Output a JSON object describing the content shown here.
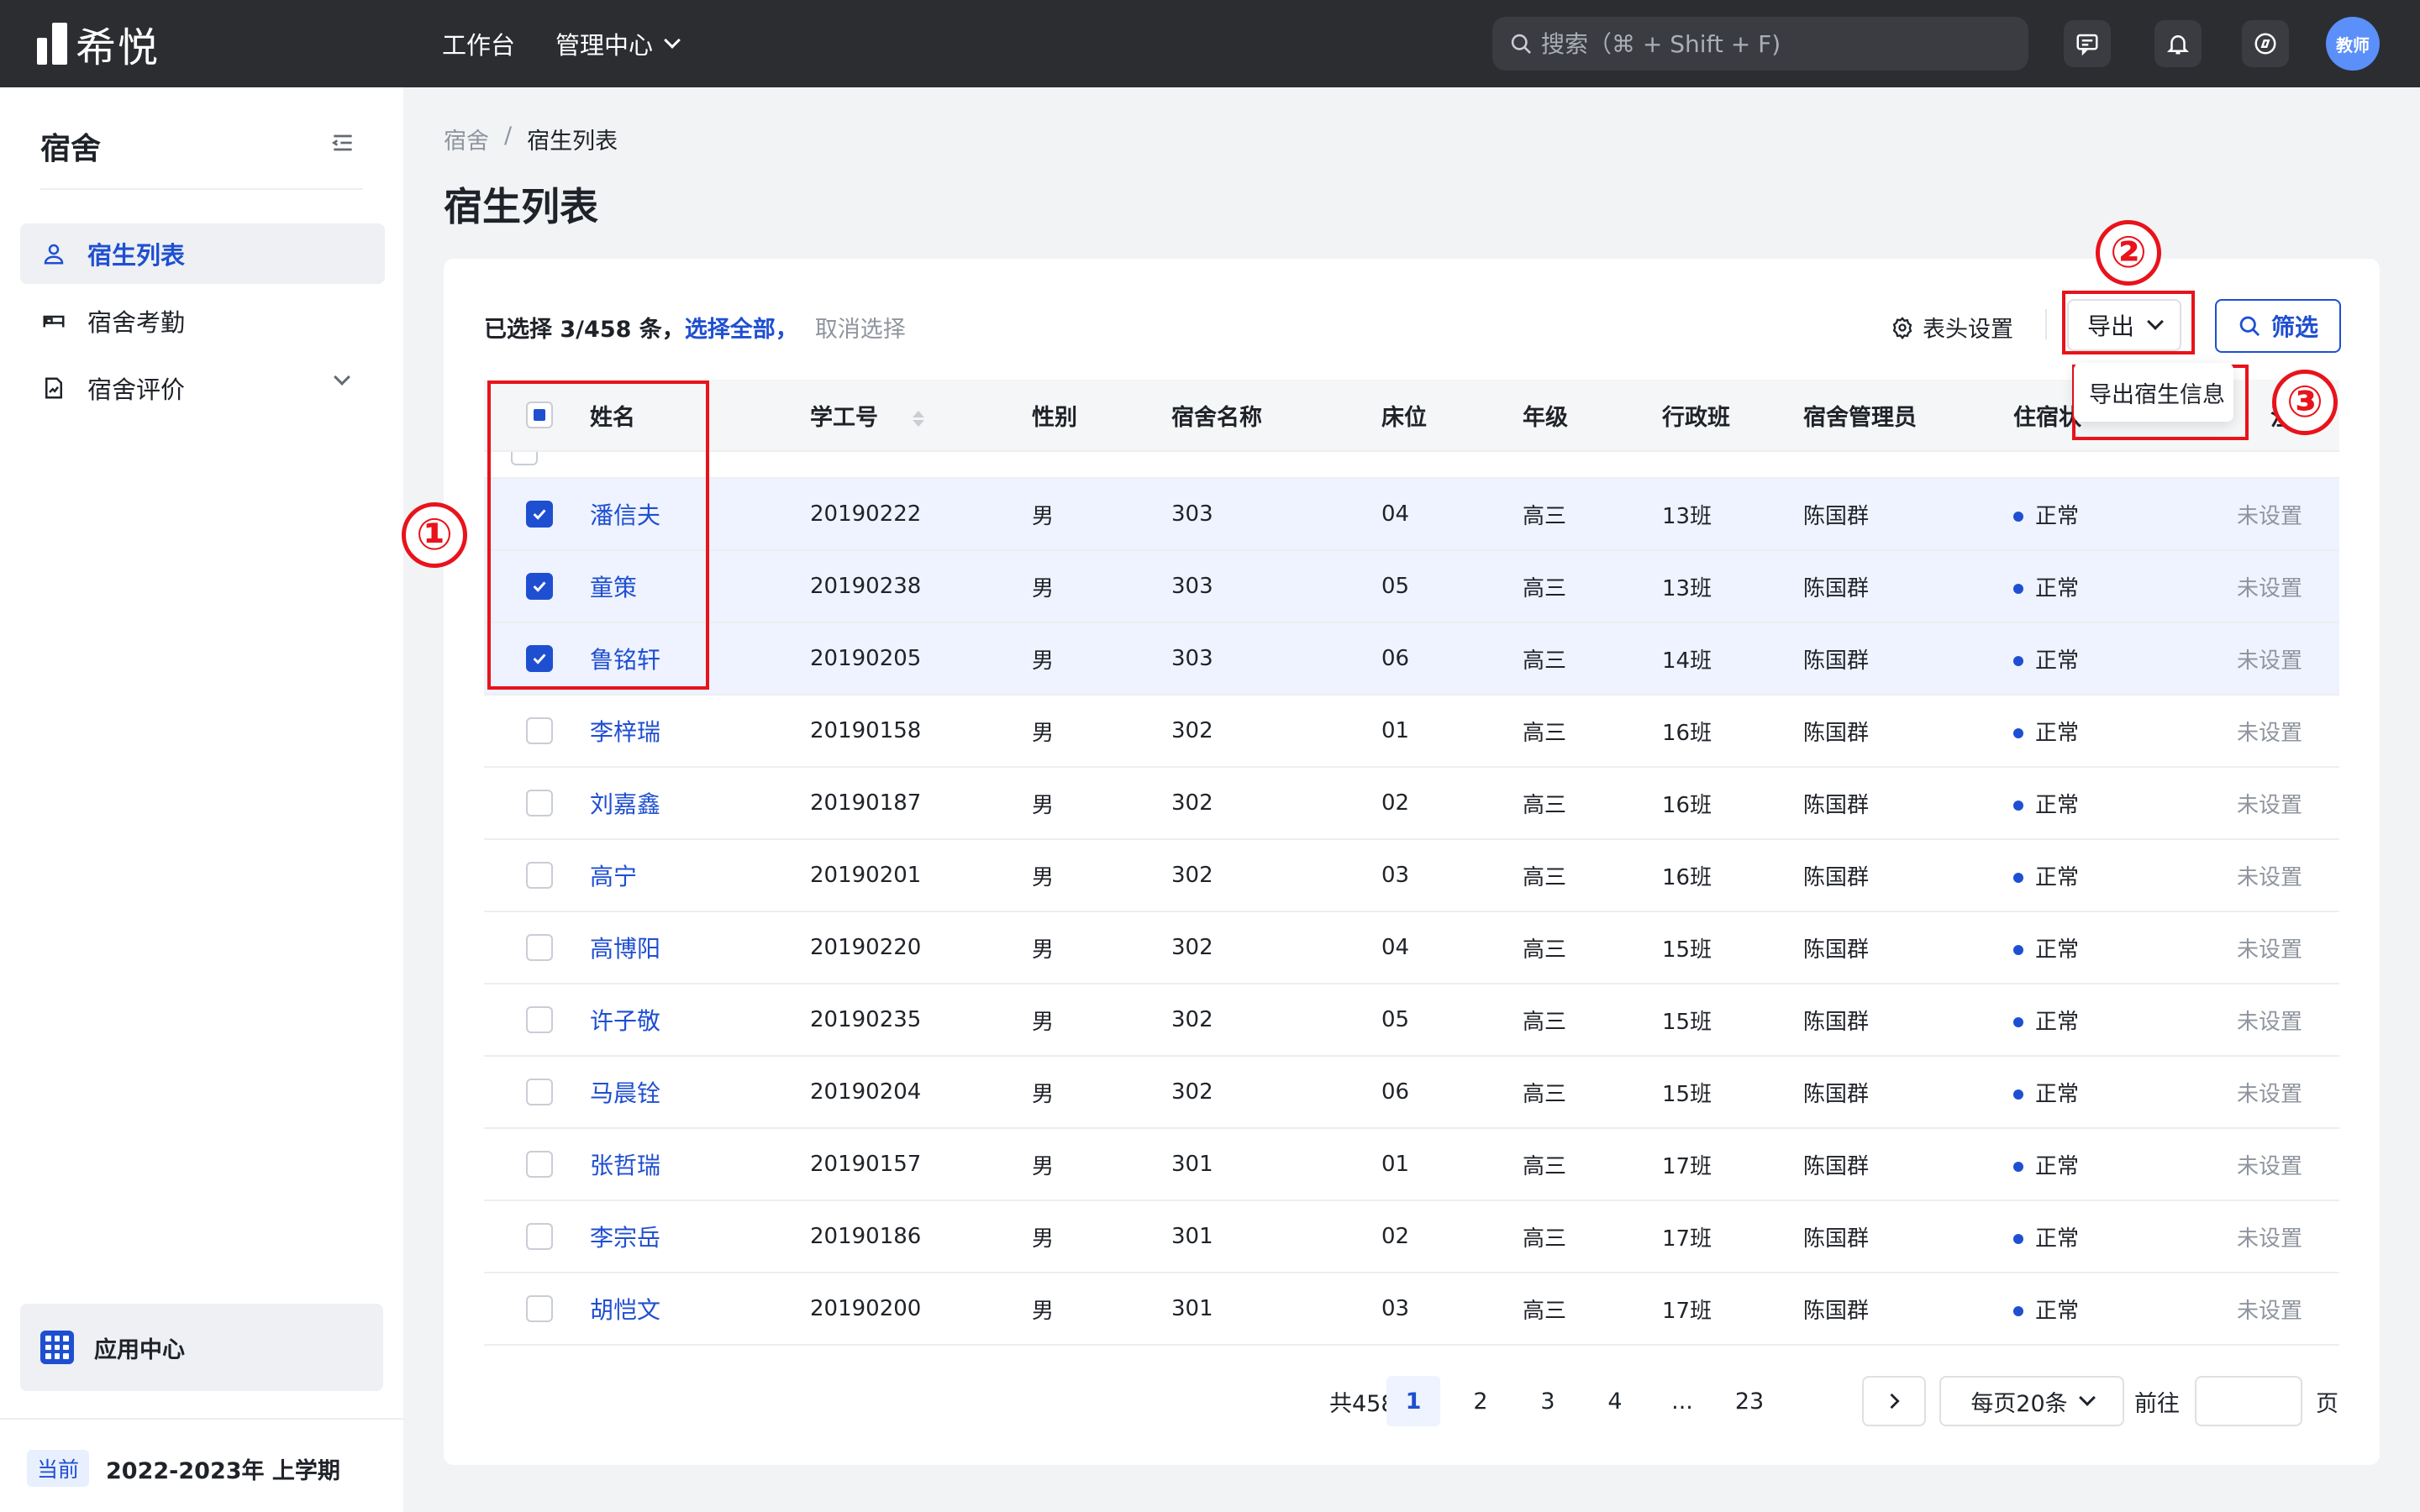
{
  "app": {
    "logo_text": "希悦"
  },
  "topnav": {
    "workbench": "工作台",
    "management": "管理中心"
  },
  "search": {
    "placeholder": "搜索（⌘ + Shift + F)"
  },
  "user": {
    "avatar_text": "教师"
  },
  "sidebar": {
    "title": "宿舍",
    "items": [
      {
        "label": "宿生列表",
        "icon": "person-icon",
        "active": true
      },
      {
        "label": "宿舍考勤",
        "icon": "bed-icon",
        "active": false
      },
      {
        "label": "宿舍评价",
        "icon": "evaluation-icon",
        "active": false,
        "expandable": true
      }
    ],
    "app_center": "应用中心",
    "term_badge": "当前",
    "term": "2022-2023年 上学期"
  },
  "breadcrumb": {
    "root": "宿舍",
    "separator": "/",
    "current": "宿生列表"
  },
  "page_title": "宿生列表",
  "selection": {
    "prefix": "已选择 3/458 条，",
    "select_all": "选择全部，",
    "cancel": "取消选择"
  },
  "toolbar": {
    "header_settings": "表头设置",
    "export": "导出",
    "filter": "筛选",
    "export_menu_item": "导出宿生信息"
  },
  "table": {
    "headers": [
      "姓名",
      "学工号",
      "性别",
      "宿舍名称",
      "床位",
      "年级",
      "行政班",
      "宿舍管理员",
      "住宿状",
      "注"
    ],
    "rows": [
      {
        "name": "潘信夫",
        "id": "20190222",
        "sex": "男",
        "dorm": "303",
        "bed": "04",
        "grade": "高三",
        "cls": "13班",
        "mgr": "陈国群",
        "status": "正常",
        "note": "未设置",
        "checked": true
      },
      {
        "name": "童策",
        "id": "20190238",
        "sex": "男",
        "dorm": "303",
        "bed": "05",
        "grade": "高三",
        "cls": "13班",
        "mgr": "陈国群",
        "status": "正常",
        "note": "未设置",
        "checked": true
      },
      {
        "name": "鲁铭轩",
        "id": "20190205",
        "sex": "男",
        "dorm": "303",
        "bed": "06",
        "grade": "高三",
        "cls": "14班",
        "mgr": "陈国群",
        "status": "正常",
        "note": "未设置",
        "checked": true
      },
      {
        "name": "李梓瑞",
        "id": "20190158",
        "sex": "男",
        "dorm": "302",
        "bed": "01",
        "grade": "高三",
        "cls": "16班",
        "mgr": "陈国群",
        "status": "正常",
        "note": "未设置",
        "checked": false
      },
      {
        "name": "刘嘉鑫",
        "id": "20190187",
        "sex": "男",
        "dorm": "302",
        "bed": "02",
        "grade": "高三",
        "cls": "16班",
        "mgr": "陈国群",
        "status": "正常",
        "note": "未设置",
        "checked": false
      },
      {
        "name": "高宁",
        "id": "20190201",
        "sex": "男",
        "dorm": "302",
        "bed": "03",
        "grade": "高三",
        "cls": "16班",
        "mgr": "陈国群",
        "status": "正常",
        "note": "未设置",
        "checked": false
      },
      {
        "name": "高博阳",
        "id": "20190220",
        "sex": "男",
        "dorm": "302",
        "bed": "04",
        "grade": "高三",
        "cls": "15班",
        "mgr": "陈国群",
        "status": "正常",
        "note": "未设置",
        "checked": false
      },
      {
        "name": "许子敬",
        "id": "20190235",
        "sex": "男",
        "dorm": "302",
        "bed": "05",
        "grade": "高三",
        "cls": "15班",
        "mgr": "陈国群",
        "status": "正常",
        "note": "未设置",
        "checked": false
      },
      {
        "name": "马晨铨",
        "id": "20190204",
        "sex": "男",
        "dorm": "302",
        "bed": "06",
        "grade": "高三",
        "cls": "15班",
        "mgr": "陈国群",
        "status": "正常",
        "note": "未设置",
        "checked": false
      },
      {
        "name": "张哲瑞",
        "id": "20190157",
        "sex": "男",
        "dorm": "301",
        "bed": "01",
        "grade": "高三",
        "cls": "17班",
        "mgr": "陈国群",
        "status": "正常",
        "note": "未设置",
        "checked": false
      },
      {
        "name": "李宗岳",
        "id": "20190186",
        "sex": "男",
        "dorm": "301",
        "bed": "02",
        "grade": "高三",
        "cls": "17班",
        "mgr": "陈国群",
        "status": "正常",
        "note": "未设置",
        "checked": false
      },
      {
        "name": "胡恺文",
        "id": "20190200",
        "sex": "男",
        "dorm": "301",
        "bed": "03",
        "grade": "高三",
        "cls": "17班",
        "mgr": "陈国群",
        "status": "正常",
        "note": "未设置",
        "checked": false
      }
    ]
  },
  "pagination": {
    "total": "共458条",
    "pages": [
      "1",
      "2",
      "3",
      "4",
      "...",
      "23"
    ],
    "current": "1",
    "page_size": "每页20条",
    "goto_label": "前往",
    "page_suffix": "页",
    "goto_value": ""
  },
  "annotations": {
    "marker1": "①",
    "marker2": "②",
    "marker3": "③"
  },
  "colors": {
    "accent": "#1f4fd1",
    "annotation": "#e8131b",
    "topbar": "#2b2d31"
  }
}
